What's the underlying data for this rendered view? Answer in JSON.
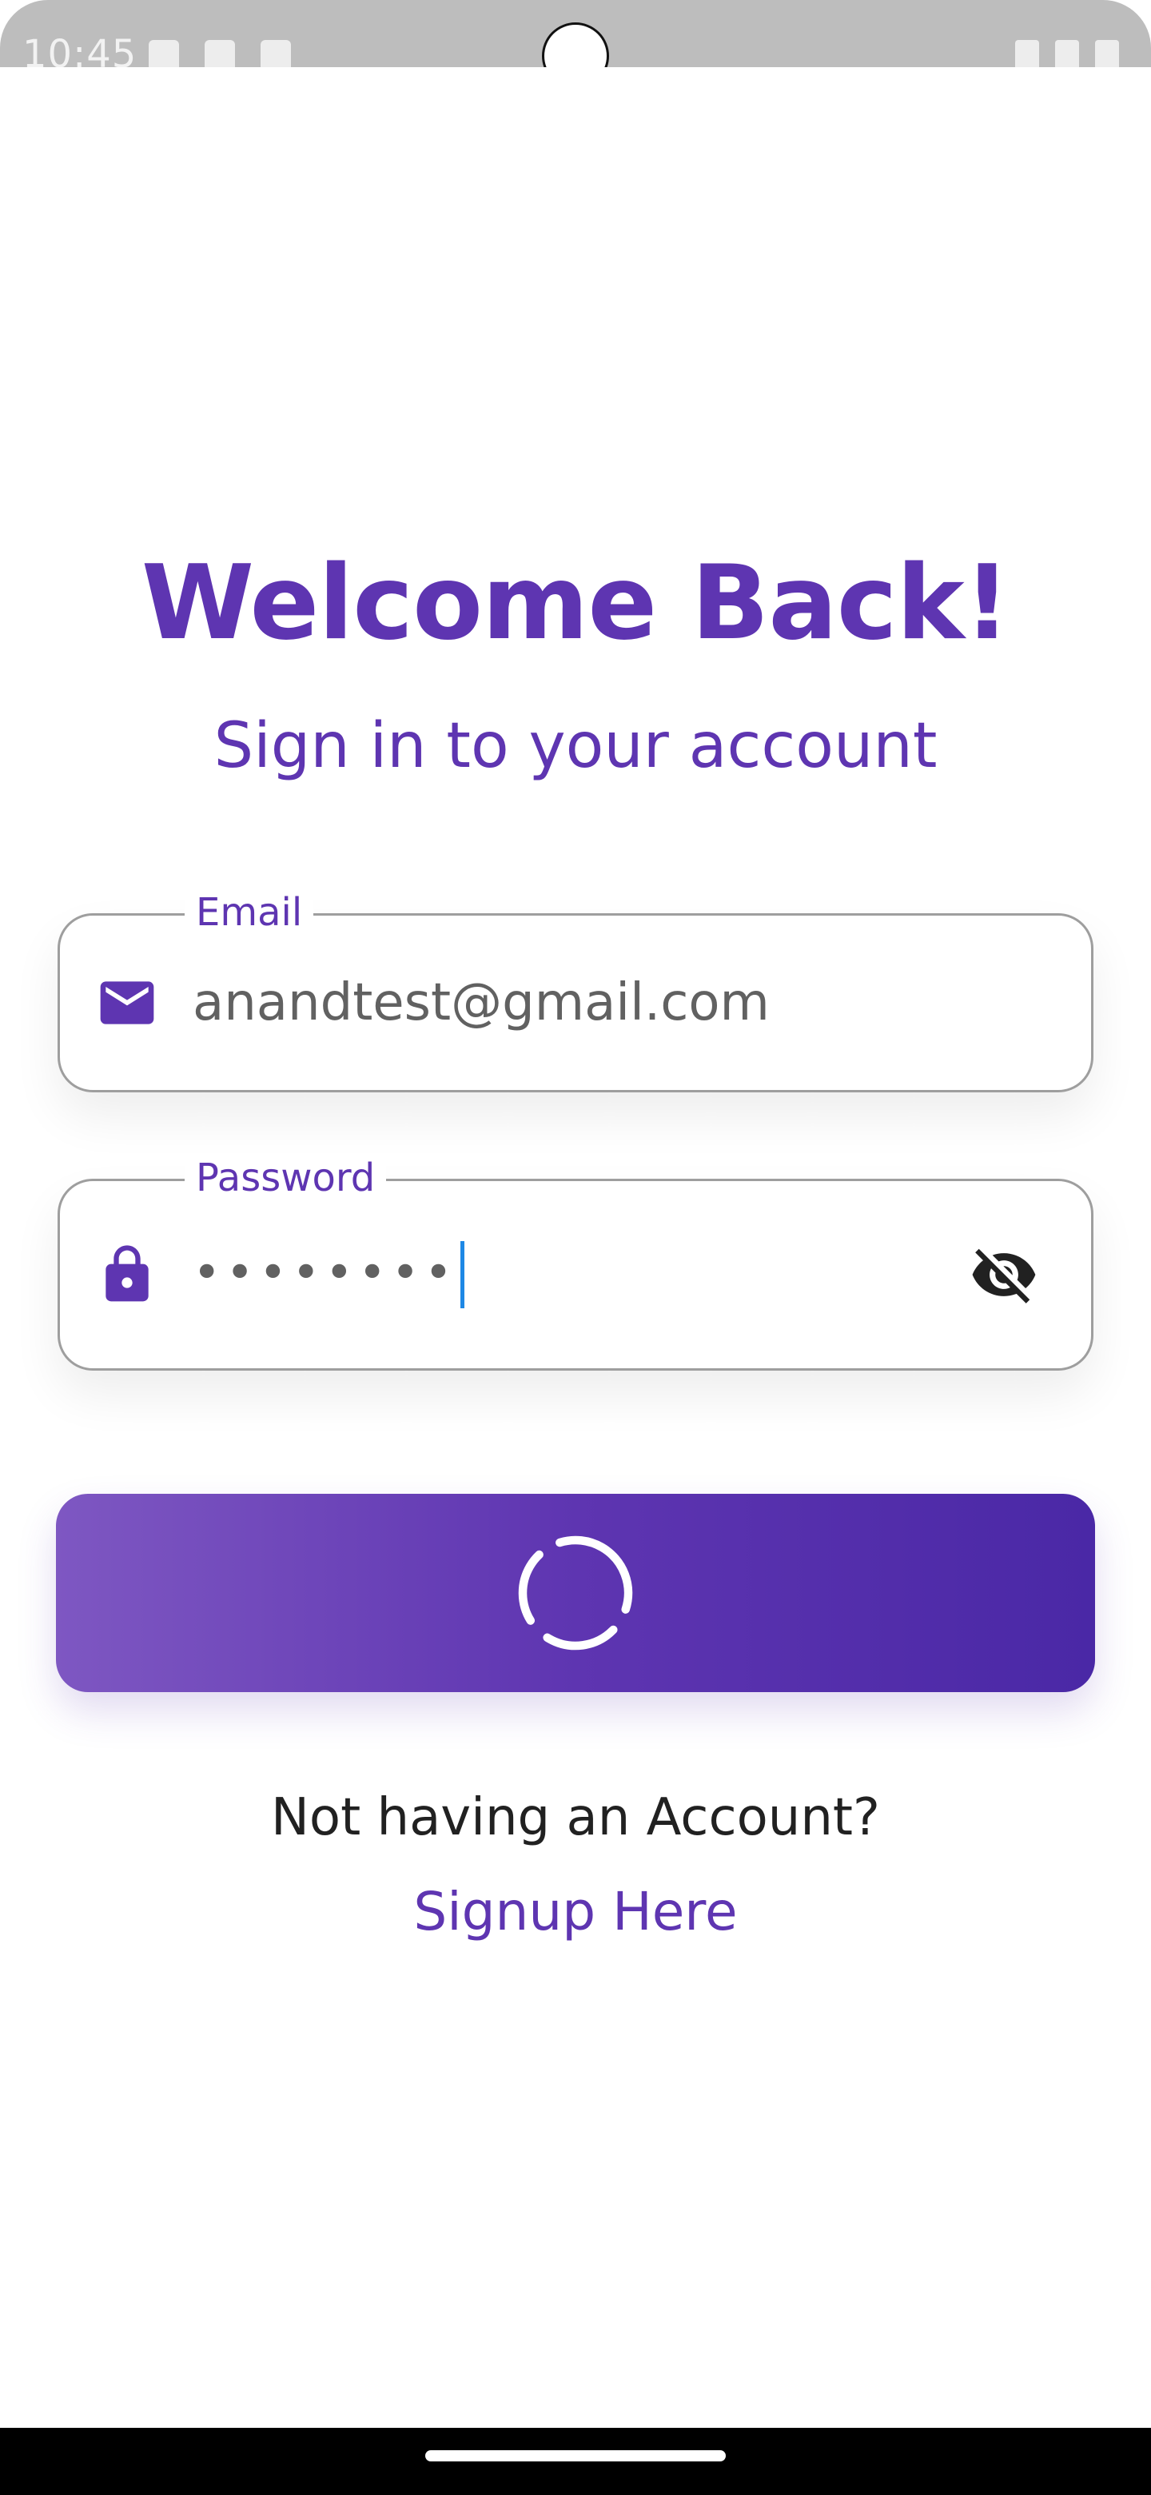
{
  "status_bar": {
    "time": "10:45"
  },
  "login": {
    "title": "Welcome Back!",
    "subtitle": "Sign in to your account",
    "email_label": "Email",
    "email_value": "anandtest@gmail.com",
    "password_label": "Password",
    "password_masked": "••••••••",
    "no_account_text": "Not having an Account?",
    "signup_link": "Signup Here",
    "loading": true
  },
  "icons": {
    "email": "mail-icon",
    "password": "lock-icon",
    "toggle": "eye-off-icon",
    "button": "spinner-icon"
  },
  "colors": {
    "accent": "#5e35b1",
    "gradient_start": "#7e57c2",
    "gradient_end": "#4a28a6",
    "caret": "#1e88e5"
  }
}
